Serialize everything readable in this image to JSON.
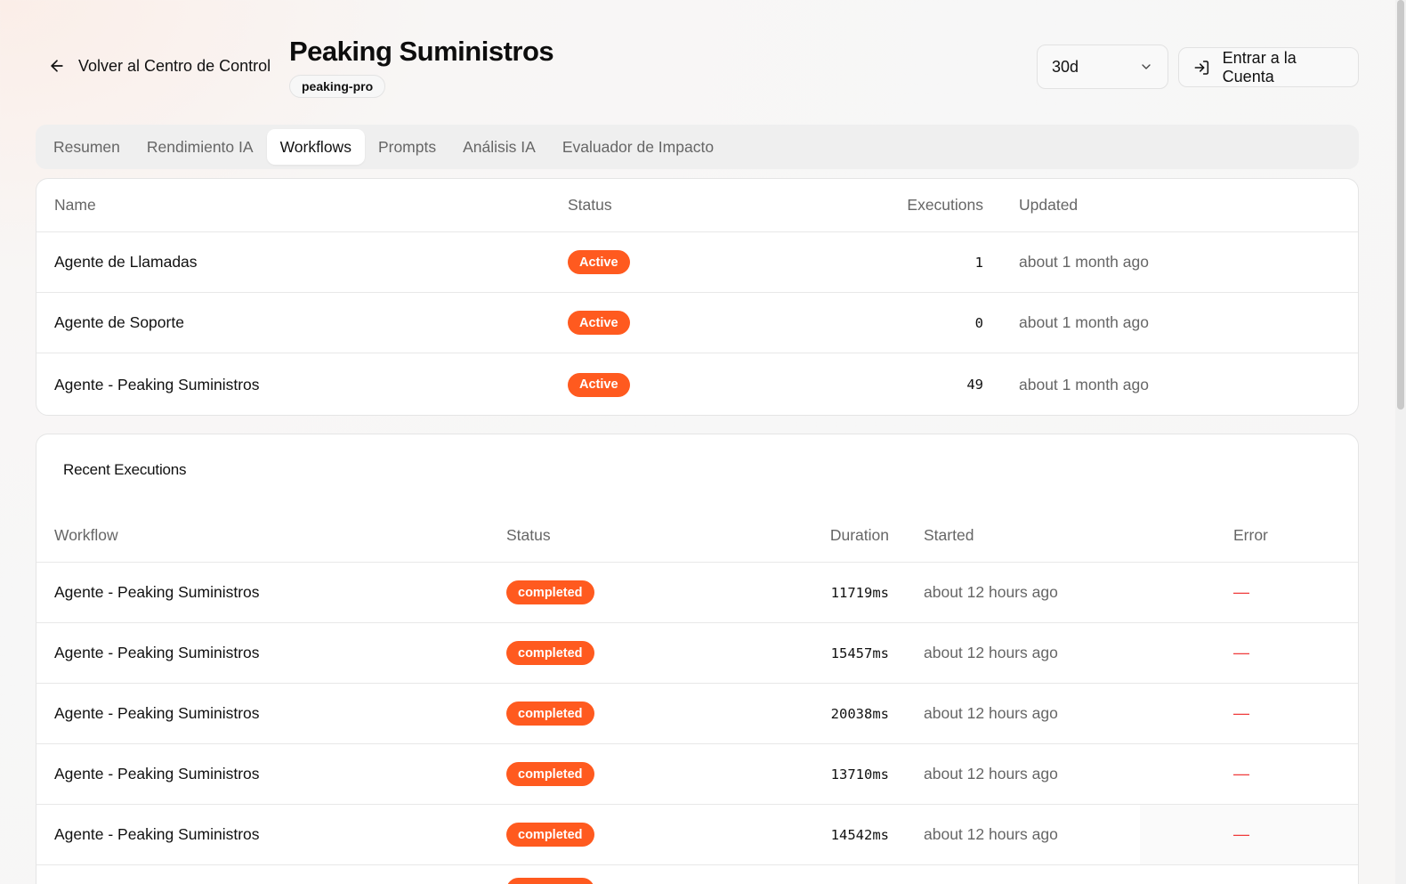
{
  "header": {
    "back_label": "Volver al Centro de Control",
    "title": "Peaking Suministros",
    "slug": "peaking-pro",
    "range_value": "30d",
    "enter_label": "Entrar a la Cuenta"
  },
  "tabs": [
    {
      "label": "Resumen"
    },
    {
      "label": "Rendimiento IA"
    },
    {
      "label": "Workflows"
    },
    {
      "label": "Prompts"
    },
    {
      "label": "Análisis IA"
    },
    {
      "label": "Evaluador de Impacto"
    }
  ],
  "active_tab": "Workflows",
  "workflows": {
    "columns": {
      "name": "Name",
      "status": "Status",
      "executions": "Executions",
      "updated": "Updated"
    },
    "rows": [
      {
        "name": "Agente de Llamadas",
        "status": "Active",
        "executions": "1",
        "updated": "about 1 month ago"
      },
      {
        "name": "Agente de Soporte",
        "status": "Active",
        "executions": "0",
        "updated": "about 1 month ago"
      },
      {
        "name": "Agente - Peaking Suministros",
        "status": "Active",
        "executions": "49",
        "updated": "about 1 month ago"
      }
    ]
  },
  "executions": {
    "title": "Recent Executions",
    "columns": {
      "workflow": "Workflow",
      "status": "Status",
      "duration": "Duration",
      "started": "Started",
      "error": "Error"
    },
    "rows": [
      {
        "workflow": "Agente - Peaking Suministros",
        "status": "completed",
        "duration": "11719ms",
        "started": "about 12 hours ago",
        "error": "—"
      },
      {
        "workflow": "Agente - Peaking Suministros",
        "status": "completed",
        "duration": "15457ms",
        "started": "about 12 hours ago",
        "error": "—"
      },
      {
        "workflow": "Agente - Peaking Suministros",
        "status": "completed",
        "duration": "20038ms",
        "started": "about 12 hours ago",
        "error": "—"
      },
      {
        "workflow": "Agente - Peaking Suministros",
        "status": "completed",
        "duration": "13710ms",
        "started": "about 12 hours ago",
        "error": "—"
      },
      {
        "workflow": "Agente - Peaking Suministros",
        "status": "completed",
        "duration": "14542ms",
        "started": "about 12 hours ago",
        "error": "—"
      },
      {
        "workflow": "",
        "status": "completed",
        "duration": "",
        "started": "",
        "error": ""
      }
    ]
  },
  "colors": {
    "accent": "#ff5a1f",
    "error_dash": "#ef3b3b"
  },
  "icons": {
    "back": "arrow-left-icon",
    "range": "chevron-down-icon",
    "enter": "log-in-icon"
  }
}
